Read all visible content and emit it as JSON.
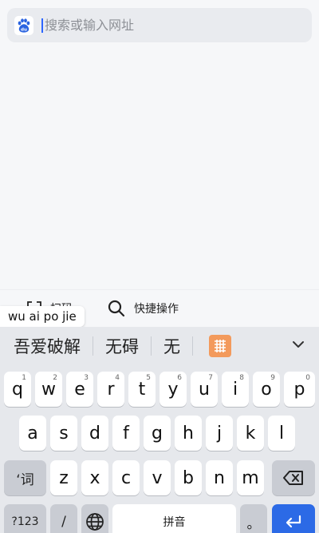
{
  "search": {
    "placeholder": "搜索或输入网址",
    "engine_icon": "baidu-paw-icon",
    "engine_logo_text": "du",
    "engine_color": "#2a63e0"
  },
  "actions": {
    "scan_label": "扫码",
    "quick_label": "快捷操作"
  },
  "ime": {
    "composition": "wu ai po jie",
    "candidates": [
      "吾爱破解",
      "无碍",
      "无"
    ],
    "grid_icon": "handwriting-grid-icon",
    "grid_color": "#f39a5c",
    "expand_icon": "chevron-down-icon"
  },
  "keyboard": {
    "row1": [
      {
        "key": "q",
        "hint": "1"
      },
      {
        "key": "w",
        "hint": "2"
      },
      {
        "key": "e",
        "hint": "3"
      },
      {
        "key": "r",
        "hint": "4"
      },
      {
        "key": "t",
        "hint": "5"
      },
      {
        "key": "y",
        "hint": "6"
      },
      {
        "key": "u",
        "hint": "7"
      },
      {
        "key": "i",
        "hint": "8"
      },
      {
        "key": "o",
        "hint": "9"
      },
      {
        "key": "p",
        "hint": "0"
      }
    ],
    "row2": [
      "a",
      "s",
      "d",
      "f",
      "g",
      "h",
      "j",
      "k",
      "l"
    ],
    "row3": [
      "z",
      "x",
      "c",
      "v",
      "b",
      "n",
      "m"
    ],
    "word_key": "‘词",
    "symbol_key": "?123",
    "slash_key": "/",
    "space_label": "拼音",
    "period_key": "。",
    "enter_color": "#2c6ae6"
  }
}
